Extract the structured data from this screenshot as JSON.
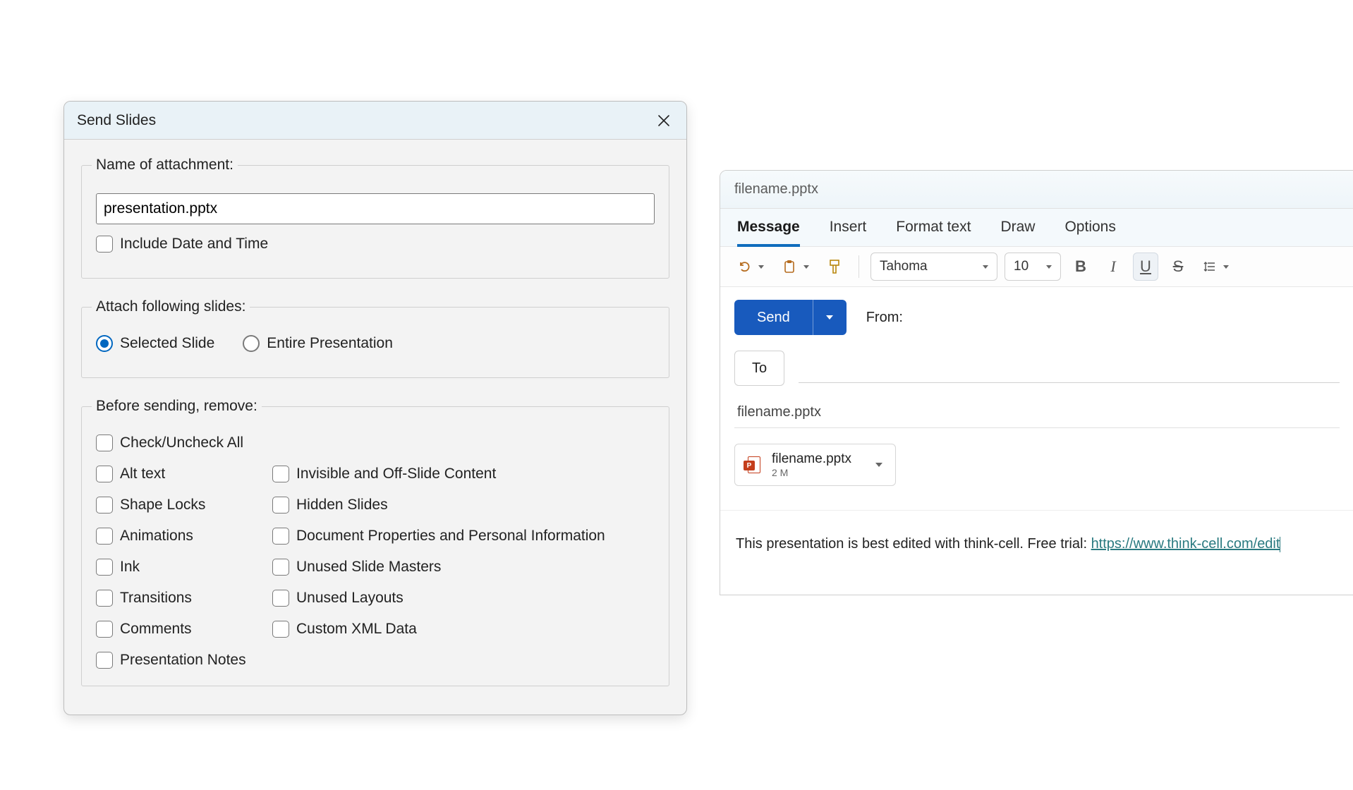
{
  "dialog": {
    "title": "Send Slides",
    "group_attachment": {
      "legend": "Name of attachment:",
      "filename": "presentation.pptx",
      "include_date": "Include Date and Time"
    },
    "group_attach": {
      "legend": "Attach following slides:",
      "opt_selected": "Selected Slide",
      "opt_entire": "Entire Presentation"
    },
    "group_remove": {
      "legend": "Before sending, remove:",
      "check_all": "Check/Uncheck All",
      "alt_text": "Alt text",
      "invisible": "Invisible and Off-Slide Content",
      "shape_locks": "Shape Locks",
      "hidden_slides": "Hidden Slides",
      "animations": "Animations",
      "doc_props": "Document Properties and Personal Information",
      "ink": "Ink",
      "unused_masters": "Unused Slide Masters",
      "transitions": "Transitions",
      "unused_layouts": "Unused Layouts",
      "comments": "Comments",
      "custom_xml": "Custom XML Data",
      "pres_notes": "Presentation Notes"
    }
  },
  "email": {
    "window_title": "filename.pptx",
    "tabs": {
      "message": "Message",
      "insert": "Insert",
      "format_text": "Format text",
      "draw": "Draw",
      "options": "Options"
    },
    "ribbon": {
      "font_name": "Tahoma",
      "font_size": "10",
      "bold": "B",
      "italic": "I",
      "underline": "U",
      "strike": "S"
    },
    "send": "Send",
    "from_label": "From:",
    "to_label": "To",
    "subject": "filename.pptx",
    "attachment": {
      "name": "filename.pptx",
      "size": "2 M",
      "icon_letter": "P"
    },
    "body_text": "This presentation is best edited with think-cell. Free trial: ",
    "body_link": "https://www.think-cell.com/edit"
  }
}
